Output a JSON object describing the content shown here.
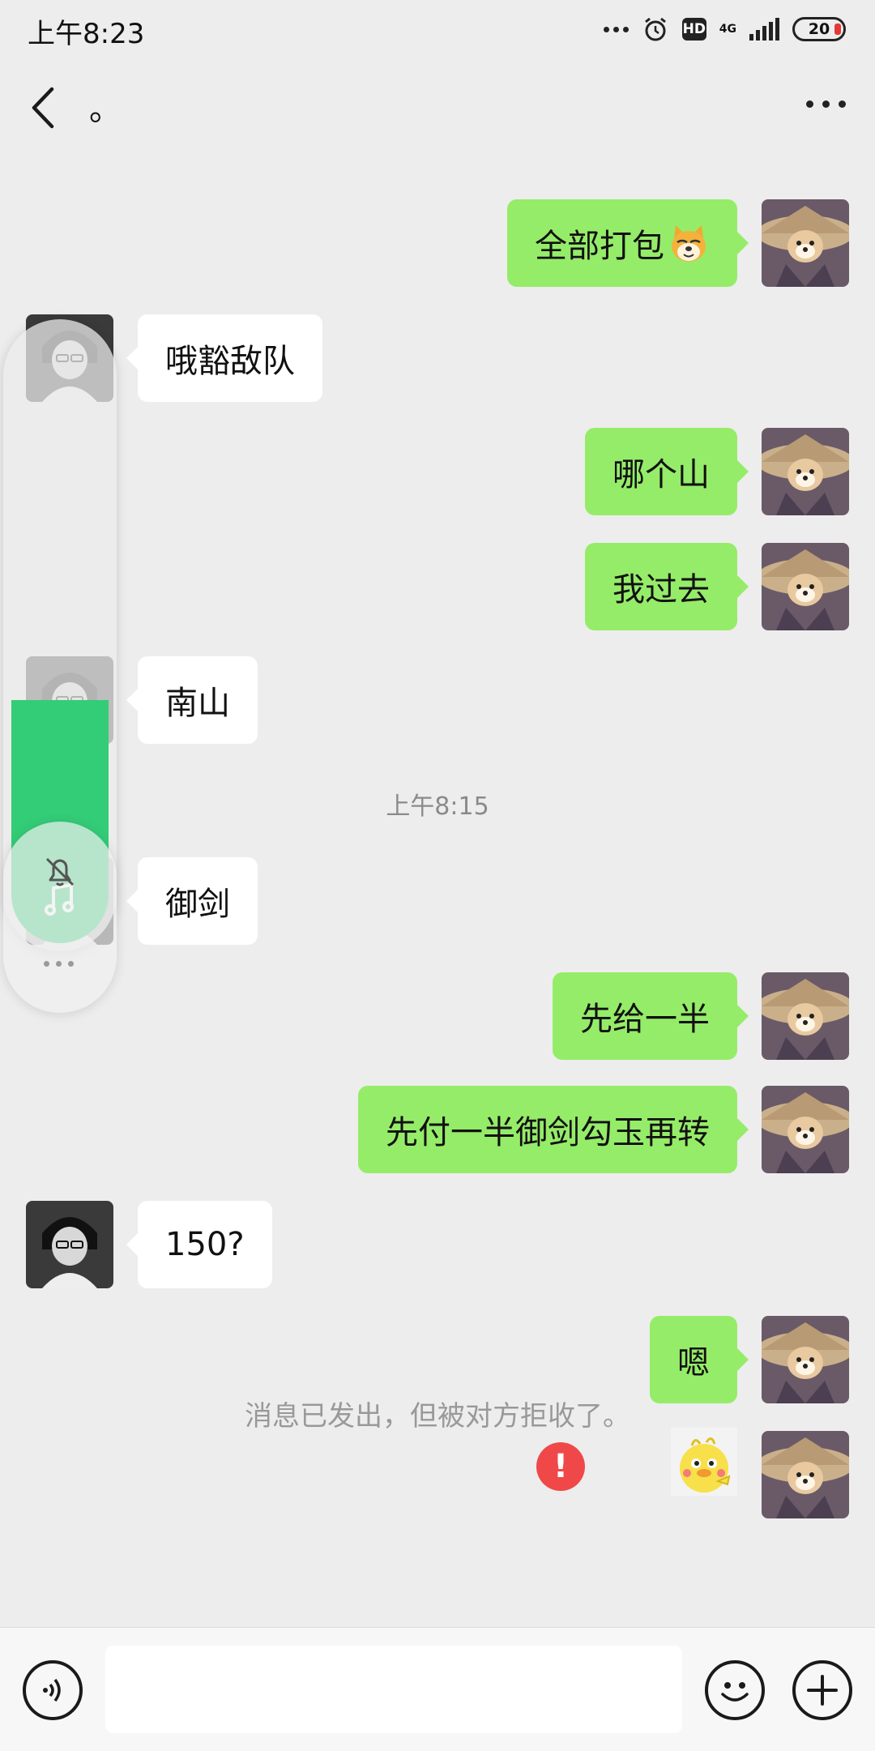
{
  "status_bar": {
    "time": "上午8:23",
    "network": "4G",
    "hd": "HD",
    "battery": "20"
  },
  "header": {
    "title": "。"
  },
  "messages": [
    {
      "side": "mine",
      "text": "全部打包",
      "emoji": "doge-emoji"
    },
    {
      "side": "theirs",
      "text": "哦豁敌队"
    },
    {
      "side": "mine",
      "text": "哪个山"
    },
    {
      "side": "mine",
      "text": "我过去"
    },
    {
      "side": "theirs",
      "text": "南山"
    },
    {
      "side": "mine",
      "text": "先给一半"
    },
    {
      "side": "mine",
      "text": "先付一半御剑勾玉再转"
    },
    {
      "side": "theirs",
      "text": "150?"
    },
    {
      "side": "mine",
      "text": "嗯"
    },
    {
      "side": "mine",
      "text": "",
      "sticker": "duck-sticker",
      "status": "failed"
    }
  ],
  "pinned_message": {
    "text": "御剑"
  },
  "timestamp": "上午8:15",
  "system_notice": "消息已发出，但被对方拒收了。",
  "error_badge": "!",
  "colors": {
    "my_bubble": "#95ec69",
    "their_bubble": "#ffffff",
    "background": "#ededed",
    "error": "#f04848",
    "float_green": "#33cc77"
  },
  "input": {
    "value": "",
    "placeholder": ""
  },
  "icons": {
    "back": "back-arrow-icon",
    "more": "more-dots-icon",
    "voice": "voice-icon",
    "emoji": "emoji-icon",
    "plus": "plus-icon",
    "music": "music-note-icon",
    "bell": "bell-off-icon"
  }
}
